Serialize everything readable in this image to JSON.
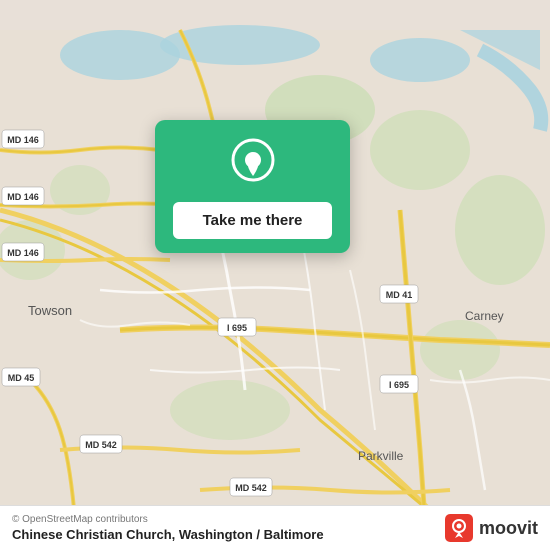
{
  "map": {
    "background_color": "#e8e0d8"
  },
  "card": {
    "button_label": "Take me there",
    "pin_color": "white"
  },
  "bottom_bar": {
    "copyright": "© OpenStreetMap contributors",
    "location_name": "Chinese Christian Church, Washington / Baltimore",
    "moovit_label": "moovit"
  },
  "road_labels": {
    "md_146_top": "MD 146",
    "md_146_mid": "MD 146",
    "md_146_bot": "MD 146",
    "i_695_left": "I 695",
    "i_695_right": "I 695",
    "md_41": "MD 41",
    "md_45": "MD 45",
    "md_542_left": "MD 542",
    "md_542_right": "MD 542",
    "towson": "Towson",
    "carney": "Carney",
    "parkville": "Parkville"
  },
  "icons": {
    "pin": "location-pin-icon",
    "moovit_brand": "moovit-brand-icon"
  }
}
